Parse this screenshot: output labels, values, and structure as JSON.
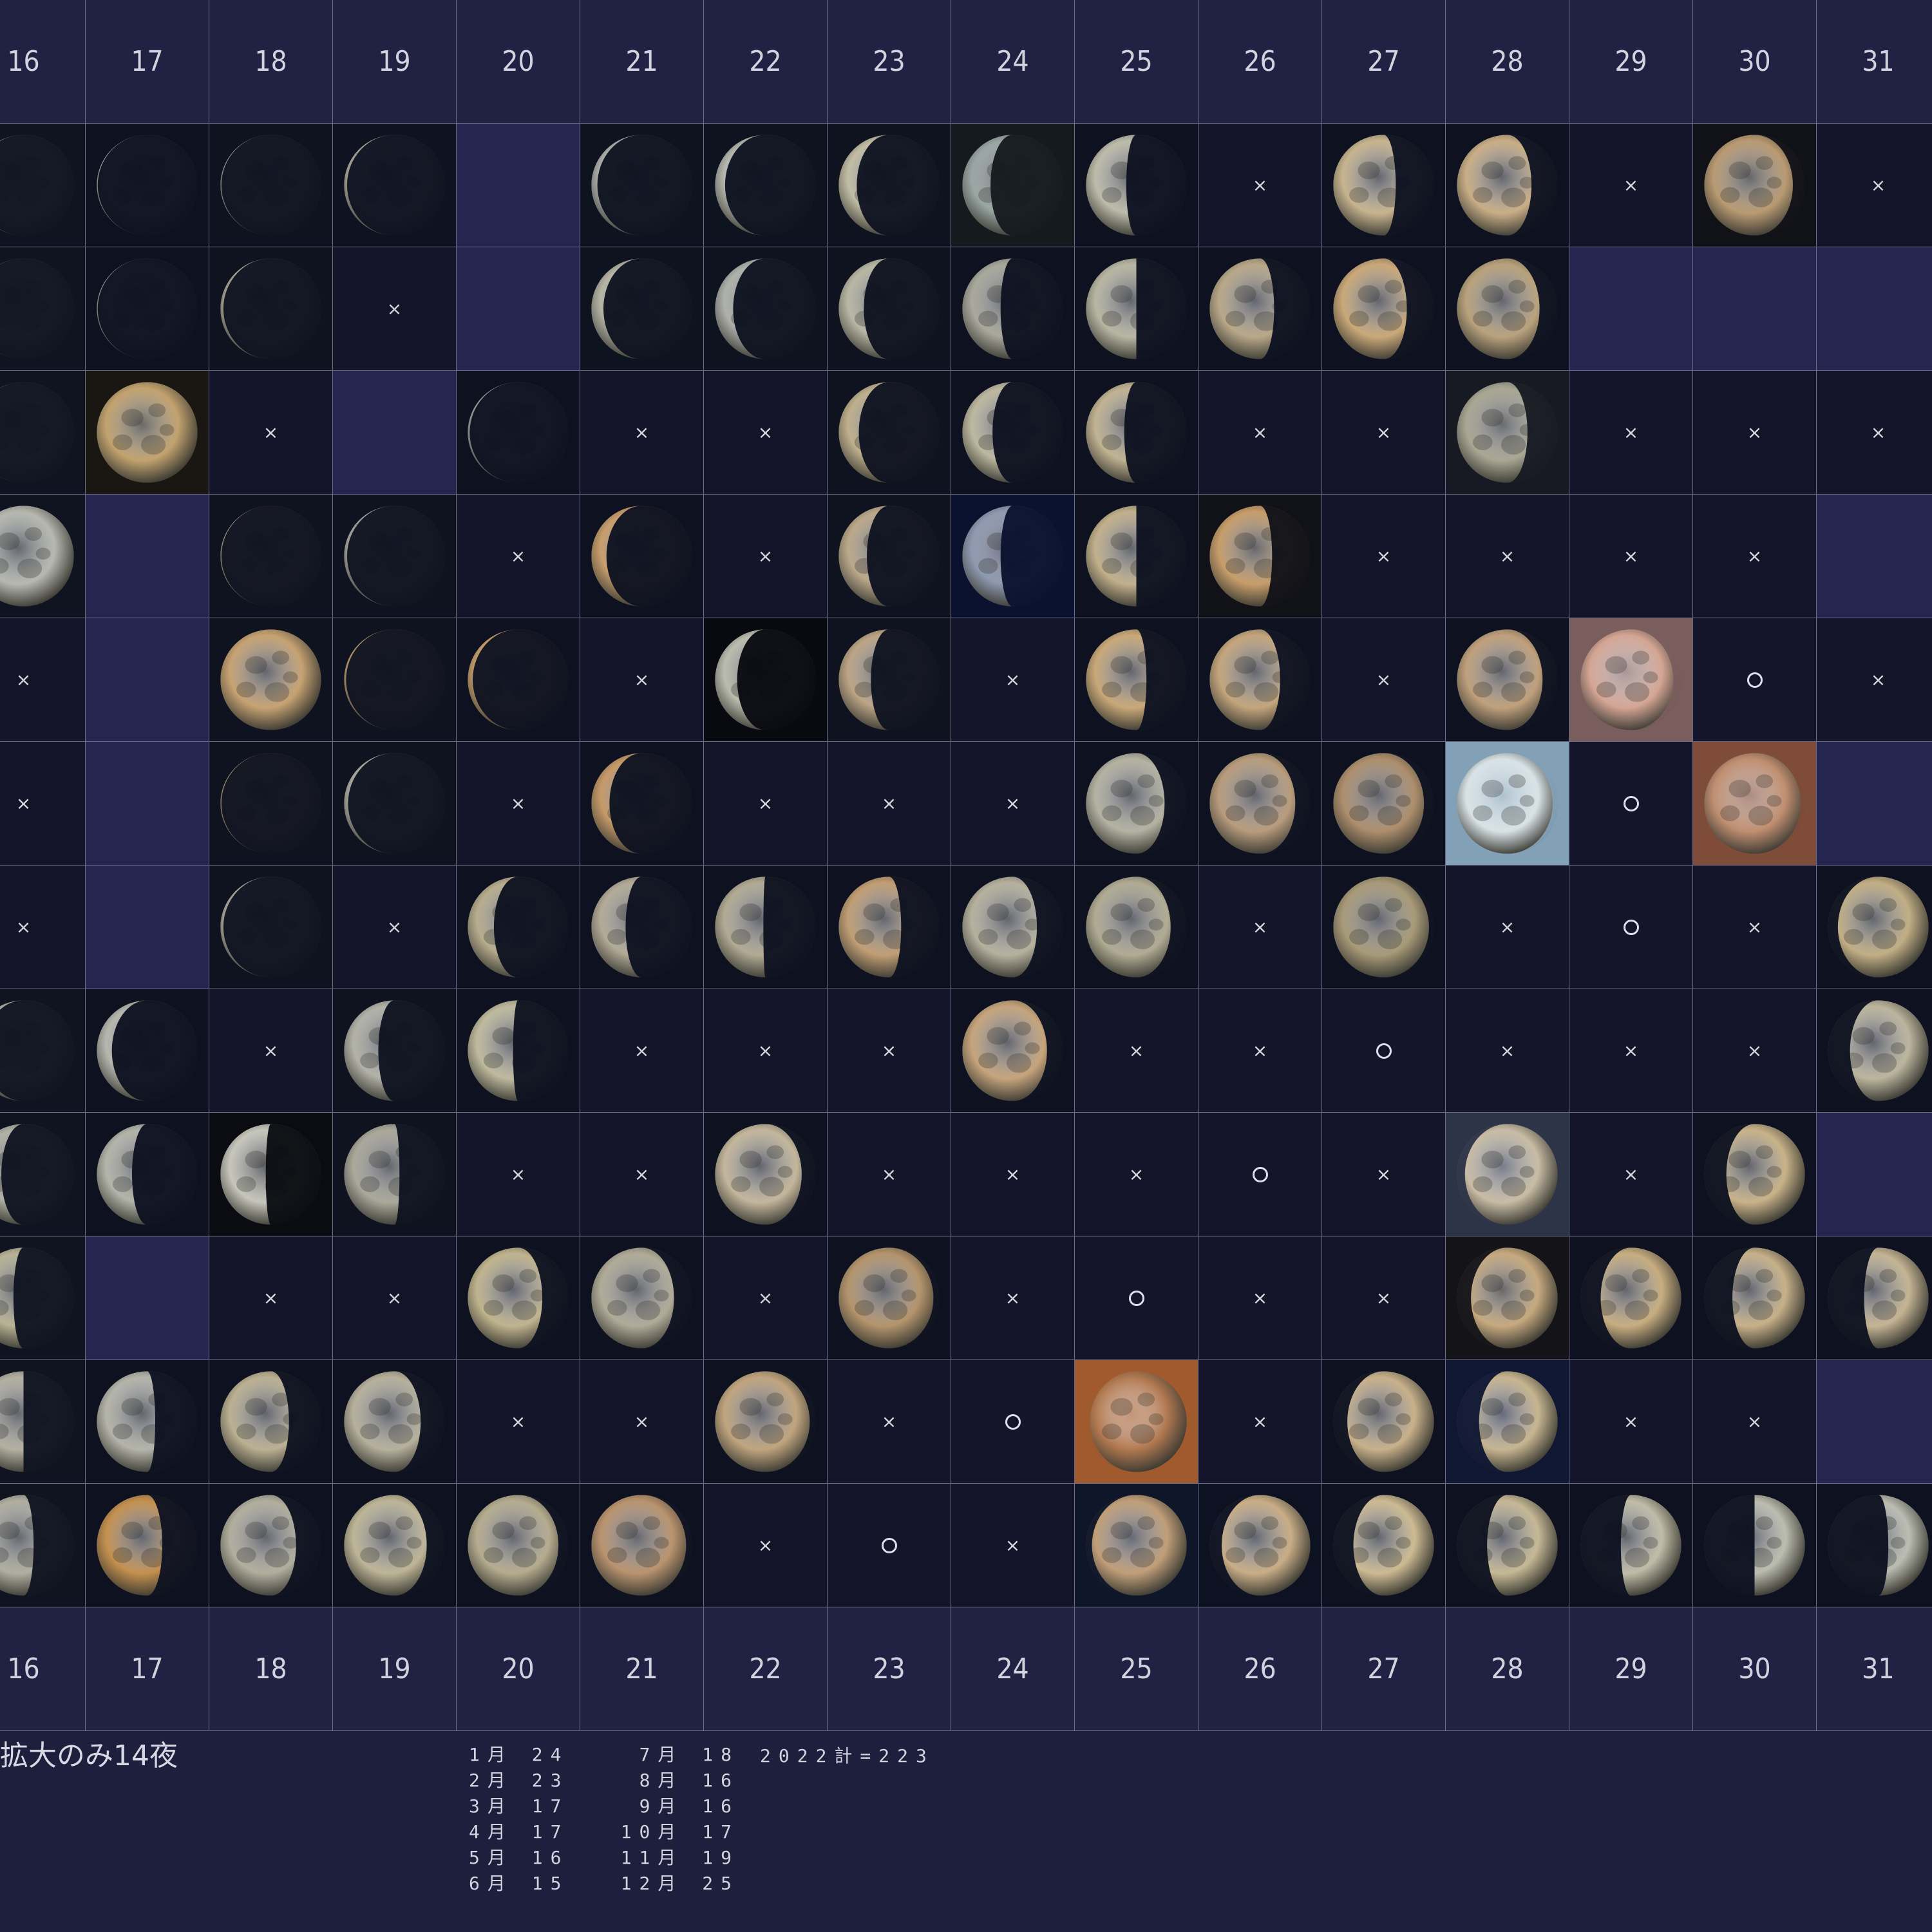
{
  "days": [
    "16",
    "17",
    "18",
    "19",
    "20",
    "21",
    "22",
    "23",
    "24",
    "25",
    "26",
    "27",
    "28",
    "29",
    "30",
    "31"
  ],
  "marks": {
    "none": "×",
    "seen": "○"
  },
  "colors": {
    "header_bg": "#212243",
    "empty_bg": "#242650",
    "blank_bg": "#14152a",
    "grid_line": "#6a6c8a"
  },
  "rows": [
    [
      {
        "t": "moon",
        "ph": 0.98,
        "tint": "#b9b9a8",
        "bg": "#0f1420"
      },
      {
        "t": "moon",
        "ph": 0.99,
        "tint": "#b5b8b2",
        "bg": "#0e1220"
      },
      {
        "t": "moon",
        "ph": 0.99,
        "tint": "#b3b5ab",
        "bg": "#0f1320"
      },
      {
        "t": "moon",
        "ph": 0.97,
        "tint": "#b7b5a3",
        "bg": "#0f1220"
      },
      {
        "t": "empty"
      },
      {
        "t": "moon",
        "ph": 0.94,
        "tint": "#b4b6b4",
        "bg": "#0e1320"
      },
      {
        "t": "moon",
        "ph": 0.9,
        "tint": "#b6b8b0",
        "bg": "#0e1320"
      },
      {
        "t": "moon",
        "ph": 0.82,
        "tint": "#c2bda5",
        "bg": "#0f1320"
      },
      {
        "t": "moon",
        "ph": 0.72,
        "tint": "#9aa6a4",
        "bg": "#151a1e"
      },
      {
        "t": "moon",
        "ph": 0.6,
        "tint": "#bdbbaa",
        "bg": "#0e1220"
      },
      {
        "t": "x"
      },
      {
        "t": "moon",
        "ph": 0.38,
        "tint": "#c7b48f",
        "bg": "#0e1220"
      },
      {
        "t": "moon",
        "ph": 0.26,
        "tint": "#c9ae86",
        "bg": "#0e1220"
      },
      {
        "t": "x"
      },
      {
        "t": "moon",
        "ph": 0.12,
        "tint": "#b99a72",
        "bg": "#111218"
      },
      {
        "t": "x"
      }
    ],
    [
      {
        "t": "moon",
        "ph": 0.99,
        "tint": "#a9b0b3",
        "bg": "#0f1420"
      },
      {
        "t": "moon",
        "ph": 0.99,
        "tint": "#a6a9a6",
        "bg": "#0e1220"
      },
      {
        "t": "moon",
        "ph": 0.97,
        "tint": "#b1b09c",
        "bg": "#0f1320"
      },
      {
        "t": "x"
      },
      {
        "t": "empty"
      },
      {
        "t": "moon",
        "ph": 0.88,
        "tint": "#b5b4a5",
        "bg": "#0e1320"
      },
      {
        "t": "moon",
        "ph": 0.82,
        "tint": "#afb1ac",
        "bg": "#0e1320"
      },
      {
        "t": "moon",
        "ph": 0.75,
        "tint": "#b9b7a4",
        "bg": "#0f1320"
      },
      {
        "t": "moon",
        "ph": 0.62,
        "tint": "#a8a89c",
        "bg": "#0e1220"
      },
      {
        "t": "moon",
        "ph": 0.5,
        "tint": "#b8b6a2",
        "bg": "#0e1220"
      },
      {
        "t": "moon",
        "ph": 0.36,
        "tint": "#b8a888",
        "bg": "#0e1220"
      },
      {
        "t": "moon",
        "ph": 0.27,
        "tint": "#caa878",
        "bg": "#0e1220"
      },
      {
        "t": "moon",
        "ph": 0.18,
        "tint": "#b9a27c",
        "bg": "#0e1220"
      },
      {
        "t": "empty"
      },
      {
        "t": "empty"
      },
      {
        "t": "empty"
      }
    ],
    [
      {
        "t": "moon",
        "ph": 0.99,
        "tint": "#b2b4b0",
        "bg": "#0f1420"
      },
      {
        "t": "moon",
        "ph": 1.0,
        "tint": "#c2a26e",
        "bg": "#1a1712"
      },
      {
        "t": "x"
      },
      {
        "t": "empty"
      },
      {
        "t": "moon",
        "ph": 0.98,
        "tint": "#a9abab",
        "bg": "#0e1220"
      },
      {
        "t": "x"
      },
      {
        "t": "x"
      },
      {
        "t": "moon",
        "ph": 0.8,
        "tint": "#bfb08c",
        "bg": "#0f1320"
      },
      {
        "t": "moon",
        "ph": 0.7,
        "tint": "#bdb8a0",
        "bg": "#0e1220"
      },
      {
        "t": "moon",
        "ph": 0.62,
        "tint": "#c1b392",
        "bg": "#0e1220"
      },
      {
        "t": "x"
      },
      {
        "t": "x"
      },
      {
        "t": "moon",
        "ph": 0.3,
        "tint": "#a9a693",
        "bg": "#171a22"
      },
      {
        "t": "x"
      },
      {
        "t": "x"
      },
      {
        "t": "x"
      }
    ],
    [
      {
        "t": "moon",
        "ph": 1.0,
        "tint": "#b6b8b0",
        "bg": "#0f1420"
      },
      {
        "t": "empty"
      },
      {
        "t": "moon",
        "ph": 0.99,
        "tint": "#c1b497",
        "bg": "#0f1320"
      },
      {
        "t": "moon",
        "ph": 0.97,
        "tint": "#b3b4ab",
        "bg": "#0f1320"
      },
      {
        "t": "x"
      },
      {
        "t": "moon",
        "ph": 0.85,
        "tint": "#c89e6c",
        "bg": "#0e1220"
      },
      {
        "t": "x"
      },
      {
        "t": "moon",
        "ph": 0.72,
        "tint": "#bba88a",
        "bg": "#0f1320"
      },
      {
        "t": "moon",
        "ph": 0.62,
        "tint": "#8e9ab0",
        "bg": "#0a1230"
      },
      {
        "t": "moon",
        "ph": 0.5,
        "tint": "#c2b08c",
        "bg": "#0e1220"
      },
      {
        "t": "moon",
        "ph": 0.38,
        "tint": "#c79d6a",
        "bg": "#111218"
      },
      {
        "t": "x"
      },
      {
        "t": "x"
      },
      {
        "t": "x"
      },
      {
        "t": "x"
      },
      {
        "t": "empty"
      }
    ],
    [
      {
        "t": "x"
      },
      {
        "t": "empty"
      },
      {
        "t": "moon",
        "ph": 1.0,
        "tint": "#c7a272",
        "bg": "#0f1320"
      },
      {
        "t": "moon",
        "ph": 0.98,
        "tint": "#c9a574",
        "bg": "#0f1320"
      },
      {
        "t": "moon",
        "ph": 0.95,
        "tint": "#d1a56e",
        "bg": "#0e1220"
      },
      {
        "t": "x"
      },
      {
        "t": "moon",
        "ph": 0.78,
        "tint": "#b9bcae",
        "bg": "#080a10"
      },
      {
        "t": "moon",
        "ph": 0.68,
        "tint": "#bca486",
        "bg": "#0f1320"
      },
      {
        "t": "x"
      },
      {
        "t": "moon",
        "ph": 0.4,
        "tint": "#c9a878",
        "bg": "#0e1220"
      },
      {
        "t": "moon",
        "ph": 0.3,
        "tint": "#c4a57c",
        "bg": "#0e1220"
      },
      {
        "t": "x"
      },
      {
        "t": "moon",
        "ph": 0.15,
        "tint": "#c0a07c",
        "bg": "#0e1220"
      },
      {
        "t": "moon",
        "ph": 0.08,
        "tint": "#d4a594",
        "bg": "#7a5e5e"
      },
      {
        "t": "o"
      },
      {
        "t": "x"
      }
    ],
    [
      {
        "t": "x"
      },
      {
        "t": "empty"
      },
      {
        "t": "moon",
        "ph": 0.99,
        "tint": "#c9ab80",
        "bg": "#0f1320"
      },
      {
        "t": "moon",
        "ph": 0.96,
        "tint": "#b8b8ad",
        "bg": "#0f1320"
      },
      {
        "t": "x"
      },
      {
        "t": "moon",
        "ph": 0.82,
        "tint": "#c69a68",
        "bg": "#0e1220"
      },
      {
        "t": "x"
      },
      {
        "t": "x"
      },
      {
        "t": "x"
      },
      {
        "t": "moon",
        "ph": 0.22,
        "tint": "#b4b2a2",
        "bg": "#0e1220"
      },
      {
        "t": "moon",
        "ph": 0.15,
        "tint": "#b89c7c",
        "bg": "#0e1220"
      },
      {
        "t": "moon",
        "ph": 0.1,
        "tint": "#ad8e6c",
        "bg": "#0e1220"
      },
      {
        "t": "moon",
        "ph": 0.05,
        "tint": "#d8e2e6",
        "bg": "#82a0b6"
      },
      {
        "t": "o"
      },
      {
        "t": "moon",
        "ph": 0.04,
        "tint": "#c08e70",
        "bg": "#7e4c38"
      },
      {
        "t": "empty"
      }
    ],
    [
      {
        "t": "x"
      },
      {
        "t": "empty"
      },
      {
        "t": "moon",
        "ph": 0.97,
        "tint": "#b6b5a6",
        "bg": "#0f1320"
      },
      {
        "t": "x"
      },
      {
        "t": "moon",
        "ph": 0.74,
        "tint": "#b7ad8e",
        "bg": "#0e1220"
      },
      {
        "t": "moon",
        "ph": 0.66,
        "tint": "#b3ab98",
        "bg": "#0e1220"
      },
      {
        "t": "moon",
        "ph": 0.52,
        "tint": "#b1aa94",
        "bg": "#0e1220"
      },
      {
        "t": "moon",
        "ph": 0.38,
        "tint": "#c19e74",
        "bg": "#0e1220"
      },
      {
        "t": "moon",
        "ph": 0.26,
        "tint": "#b6b19e",
        "bg": "#0e1220"
      },
      {
        "t": "moon",
        "ph": 0.16,
        "tint": "#b1ab93",
        "bg": "#0e1220"
      },
      {
        "t": "x"
      },
      {
        "t": "moon",
        "ph": 0.05,
        "tint": "#a89a78",
        "bg": "#0e1220"
      },
      {
        "t": "x"
      },
      {
        "t": "o"
      },
      {
        "t": "x"
      },
      {
        "t": "moon",
        "ph": 0.1,
        "waxing": true,
        "tint": "#c1ae84",
        "bg": "#0e1220"
      }
    ],
    [
      {
        "t": "moon",
        "ph": 0.9,
        "tint": "#b1b2ab",
        "bg": "#0f1420"
      },
      {
        "t": "moon",
        "ph": 0.85,
        "tint": "#b6b7ae",
        "bg": "#0e1220"
      },
      {
        "t": "x"
      },
      {
        "t": "moon",
        "ph": 0.66,
        "tint": "#b2b2a8",
        "bg": "#0f1320"
      },
      {
        "t": "moon",
        "ph": 0.55,
        "tint": "#bfba9e",
        "bg": "#0e1220"
      },
      {
        "t": "x"
      },
      {
        "t": "x"
      },
      {
        "t": "x"
      },
      {
        "t": "moon",
        "ph": 0.16,
        "tint": "#c6a47c",
        "bg": "#0e1220"
      },
      {
        "t": "x"
      },
      {
        "t": "x"
      },
      {
        "t": "o"
      },
      {
        "t": "x"
      },
      {
        "t": "x"
      },
      {
        "t": "x"
      },
      {
        "t": "moon",
        "ph": 0.22,
        "waxing": true,
        "tint": "#bcb59e",
        "bg": "#0e1220"
      }
    ],
    [
      {
        "t": "moon",
        "ph": 0.72,
        "tint": "#b0b1a6",
        "bg": "#0f1420"
      },
      {
        "t": "moon",
        "ph": 0.65,
        "tint": "#b3b4aa",
        "bg": "#0e1220"
      },
      {
        "t": "moon",
        "ph": 0.55,
        "tint": "#c6c6bc",
        "bg": "#0a0c12"
      },
      {
        "t": "moon",
        "ph": 0.45,
        "tint": "#aaa89a",
        "bg": "#0f1320"
      },
      {
        "t": "x"
      },
      {
        "t": "x"
      },
      {
        "t": "moon",
        "ph": 0.14,
        "tint": "#c3b69c",
        "bg": "#0e1220"
      },
      {
        "t": "x"
      },
      {
        "t": "x"
      },
      {
        "t": "x"
      },
      {
        "t": "o"
      },
      {
        "t": "x"
      },
      {
        "t": "moon",
        "ph": 0.08,
        "waxing": true,
        "tint": "#c8bca4",
        "bg": "#2e3448"
      },
      {
        "t": "x"
      },
      {
        "t": "moon",
        "ph": 0.22,
        "waxing": true,
        "tint": "#c8b288",
        "bg": "#0e1220"
      },
      {
        "t": "empty"
      }
    ],
    [
      {
        "t": "moon",
        "ph": 0.6,
        "tint": "#b8b295",
        "bg": "#0f1420"
      },
      {
        "t": "empty"
      },
      {
        "t": "x"
      },
      {
        "t": "x"
      },
      {
        "t": "moon",
        "ph": 0.26,
        "tint": "#c0b48e",
        "bg": "#0e1220"
      },
      {
        "t": "moon",
        "ph": 0.18,
        "tint": "#b0ab98",
        "bg": "#0e1220"
      },
      {
        "t": "x"
      },
      {
        "t": "moon",
        "ph": 0.06,
        "tint": "#b4946c",
        "bg": "#0e1220"
      },
      {
        "t": "x"
      },
      {
        "t": "o"
      },
      {
        "t": "x"
      },
      {
        "t": "x"
      },
      {
        "t": "moon",
        "ph": 0.14,
        "waxing": true,
        "tint": "#c6a97e",
        "bg": "#141418"
      },
      {
        "t": "moon",
        "ph": 0.2,
        "waxing": true,
        "tint": "#c7ad80",
        "bg": "#0e1220"
      },
      {
        "t": "moon",
        "ph": 0.28,
        "waxing": true,
        "tint": "#c6b088",
        "bg": "#0e1220"
      },
      {
        "t": "moon",
        "ph": 0.36,
        "waxing": true,
        "tint": "#c4b493",
        "bg": "#0e1220"
      }
    ],
    [
      {
        "t": "moon",
        "ph": 0.5,
        "tint": "#b3b0a1",
        "bg": "#0f1420"
      },
      {
        "t": "moon",
        "ph": 0.42,
        "tint": "#b4b4aa",
        "bg": "#0e1220"
      },
      {
        "t": "moon",
        "ph": 0.32,
        "tint": "#bbb092",
        "bg": "#0e1220"
      },
      {
        "t": "moon",
        "ph": 0.24,
        "tint": "#b6b09c",
        "bg": "#0e1220"
      },
      {
        "t": "x"
      },
      {
        "t": "x"
      },
      {
        "t": "moon",
        "ph": 0.06,
        "tint": "#c0a47e",
        "bg": "#0e1220"
      },
      {
        "t": "x"
      },
      {
        "t": "o"
      },
      {
        "t": "moon",
        "ph": 0.04,
        "waxing": true,
        "tint": "#b07850",
        "bg": "#a05a2e"
      },
      {
        "t": "x"
      },
      {
        "t": "moon",
        "ph": 0.14,
        "waxing": true,
        "tint": "#c8b08a",
        "bg": "#0e1220"
      },
      {
        "t": "moon",
        "ph": 0.22,
        "waxing": true,
        "tint": "#c7b590",
        "bg": "#101733"
      },
      {
        "t": "x"
      },
      {
        "t": "x"
      },
      {
        "t": "empty"
      }
    ],
    [
      {
        "t": "moon",
        "ph": 0.4,
        "tint": "#b0aea0",
        "bg": "#0f1420"
      },
      {
        "t": "moon",
        "ph": 0.35,
        "tint": "#c4904e",
        "bg": "#0e1220"
      },
      {
        "t": "moon",
        "ph": 0.25,
        "tint": "#b2ae9e",
        "bg": "#0e1220"
      },
      {
        "t": "moon",
        "ph": 0.18,
        "tint": "#bdb597",
        "bg": "#0e1220"
      },
      {
        "t": "moon",
        "ph": 0.1,
        "tint": "#b5ac8f",
        "bg": "#0e1220"
      },
      {
        "t": "moon",
        "ph": 0.06,
        "tint": "#b9936e",
        "bg": "#0e1220"
      },
      {
        "t": "x"
      },
      {
        "t": "o"
      },
      {
        "t": "x"
      },
      {
        "t": "moon",
        "ph": 0.06,
        "waxing": true,
        "tint": "#c09e78",
        "bg": "#10162a"
      },
      {
        "t": "moon",
        "ph": 0.12,
        "waxing": true,
        "tint": "#c9ad86",
        "bg": "#0c1222"
      },
      {
        "t": "moon",
        "ph": 0.2,
        "waxing": true,
        "tint": "#ccba92",
        "bg": "#0e1220"
      },
      {
        "t": "moon",
        "ph": 0.3,
        "waxing": true,
        "tint": "#c6b895",
        "bg": "#0e1220"
      },
      {
        "t": "moon",
        "ph": 0.4,
        "waxing": true,
        "tint": "#c1bca8",
        "bg": "#0e1220"
      },
      {
        "t": "moon",
        "ph": 0.5,
        "waxing": true,
        "tint": "#bcbdb0",
        "bg": "#0e1220"
      },
      {
        "t": "moon",
        "ph": 0.6,
        "waxing": true,
        "tint": "#bbbdb2",
        "bg": "#0e1220"
      }
    ]
  ],
  "footer": {
    "note": "拡大のみ14夜",
    "months": [
      {
        "a": "1月 24",
        "b": "7月 18"
      },
      {
        "a": "2月 23",
        "b": "8月 16"
      },
      {
        "a": "3月 17",
        "b": "9月 16"
      },
      {
        "a": "4月 17",
        "b": "10月 17"
      },
      {
        "a": "5月 16",
        "b": "11月 19"
      },
      {
        "a": "6月 15",
        "b": "12月 25"
      }
    ],
    "total": "2022計=223"
  }
}
